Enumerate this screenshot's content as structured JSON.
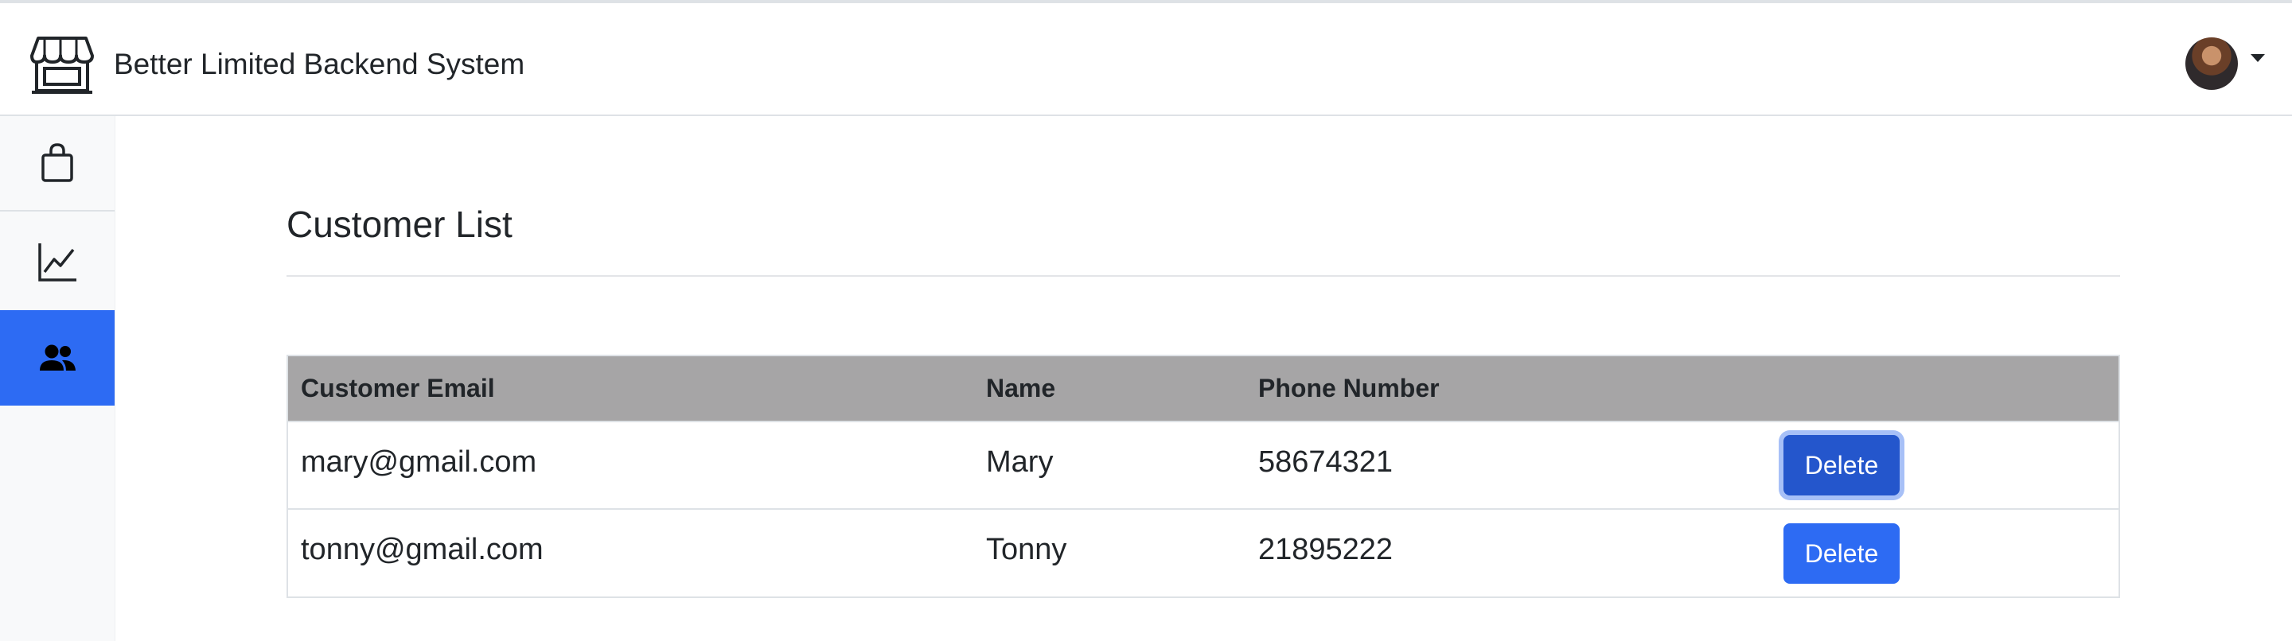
{
  "header": {
    "title": "Better Limited Backend System",
    "brand_icon": "shop-icon",
    "avatar": "user-avatar",
    "menu_icon": "caret-down-icon"
  },
  "sidebar": {
    "items": [
      {
        "icon": "shopping-bag-icon",
        "active": false
      },
      {
        "icon": "graph-up-icon",
        "active": false
      },
      {
        "icon": "people-icon",
        "active": true
      }
    ],
    "active_color": "#2d6bf3"
  },
  "main": {
    "title": "Customer List",
    "table": {
      "headers": [
        "Customer Email",
        "Name",
        "Phone Number",
        ""
      ],
      "rows": [
        {
          "email": "mary@gmail.com",
          "name": "Mary",
          "phone": "58674321",
          "action": "Delete"
        },
        {
          "email": "tonny@gmail.com",
          "name": "Tonny",
          "phone": "21895222",
          "action": "Delete"
        }
      ],
      "header_bg": "#a6a5a6"
    },
    "button_color": "#2d6bf3"
  }
}
